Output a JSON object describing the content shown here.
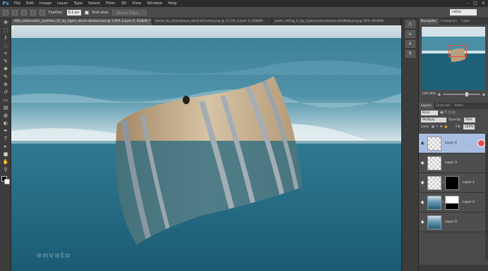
{
  "app": {
    "logo": "Ps"
  },
  "menu": [
    "File",
    "Edit",
    "Image",
    "Layer",
    "Type",
    "Select",
    "Filter",
    "3D",
    "View",
    "Window",
    "Help"
  ],
  "window_controls": [
    "–",
    "□",
    "✕"
  ],
  "options_bar": {
    "feather_label": "Feather:",
    "feather_value": "0.1 px",
    "antialias_label": "Anti-alias",
    "refine_label": "Refine Edge...",
    "workspace": "rafya"
  },
  "tabs": [
    {
      "label": "400_underwater_partition_01_by_ligors_stock-d4v4ud.psd @ 139% (Layer 4, RGB/8) *",
      "active": true
    },
    {
      "label": "barrel_by_idumakaya_stock-d7vxeck.png @ 11.2% (Layer 4, RGB/8)",
      "active": false
    },
    {
      "label": "palm_sitting_in_by_inpilcounterphotok-d140k6q.png @ 16% (RGB/8)",
      "active": false
    }
  ],
  "tools": [
    "move-icon",
    "marquee-icon",
    "lasso-icon",
    "quick-select-icon",
    "crop-icon",
    "eyedropper-icon",
    "healing-icon",
    "brush-icon",
    "clone-stamp-icon",
    "history-brush-icon",
    "eraser-icon",
    "gradient-icon",
    "blur-icon",
    "dodge-icon",
    "pen-icon",
    "type-icon",
    "path-select-icon",
    "shape-icon",
    "hand-icon",
    "zoom-icon"
  ],
  "tool_glyphs": [
    "✥",
    "⬚",
    "ℓ",
    "◌",
    "⌗",
    "✎",
    "✚",
    "✎",
    "⊕",
    "↺",
    "▭",
    "▤",
    "◍",
    "◐",
    "✒",
    "T",
    "▸",
    "■",
    "✋",
    "⚲"
  ],
  "navigator": {
    "tabs": [
      "Navigator",
      "Histogram",
      "Color"
    ],
    "zoom": "139.28%"
  },
  "layers_panel": {
    "tabs": [
      "Layers",
      "Channels",
      "Paths"
    ],
    "kind_label": "Kind",
    "blend_mode": "Multiply",
    "opacity_label": "Opacity:",
    "opacity_value": "70%",
    "lock_label": "Lock:",
    "fill_label": "Fill:",
    "fill_value": "100%",
    "layers": [
      {
        "name": "Layer 4",
        "selected": true,
        "thumb": "transparent",
        "mask": ""
      },
      {
        "name": "Layer 3",
        "selected": false,
        "thumb": "transparent",
        "mask": ""
      },
      {
        "name": "Layer 1",
        "selected": false,
        "thumb": "transparent",
        "mask": "black"
      },
      {
        "name": "Layer 2",
        "selected": false,
        "thumb": "water",
        "mask": "split"
      },
      {
        "name": "Layer 0",
        "selected": false,
        "thumb": "water",
        "mask": ""
      }
    ]
  },
  "colors": {
    "water_dark": "#1f5d74",
    "water_light": "#3f8aa5",
    "sky": "#c9dae0",
    "selected_layer": "#a9bde0"
  }
}
